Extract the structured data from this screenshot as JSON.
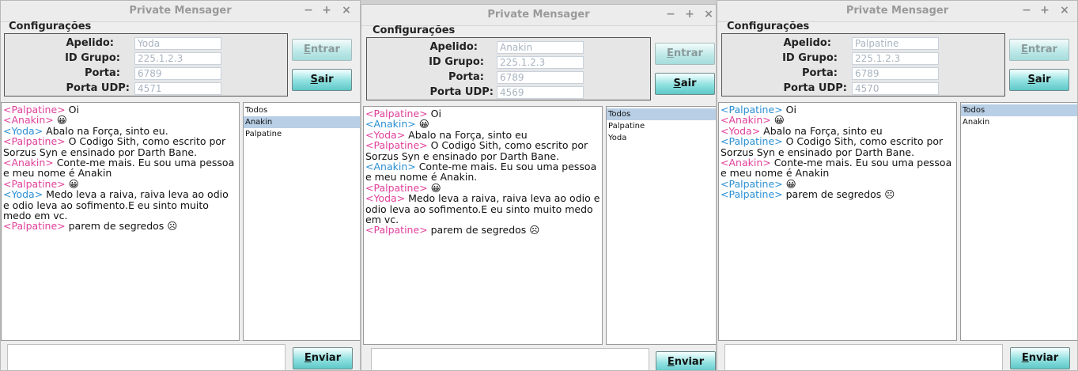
{
  "colors": {
    "palpatine": "#e0409a",
    "anakin": "#e0409a",
    "yoda": "#2a8fd4"
  },
  "common": {
    "window_title": "Private Mensager",
    "config_label": "Configurações",
    "apelido_label": "Apelido:",
    "grupo_label": "ID Grupo:",
    "porta_label": "Porta:",
    "udp_label": "Porta UDP:",
    "enter_label": "Entrar",
    "exit_label": "Sair",
    "send_label": "Enviar",
    "minimize": "−",
    "maximize": "+",
    "close": "×"
  },
  "windows": [
    {
      "apelido": "Yoda",
      "grupo": "225.1.2.3",
      "porta": "6789",
      "udp": "4571",
      "messages": [
        {
          "nick": "<Palpatine>",
          "who": "palpatine",
          "text": " Oi"
        },
        {
          "nick": "<Anakin>",
          "who": "anakin",
          "text": " 😀"
        },
        {
          "nick": "<Yoda>",
          "who": "yoda",
          "text": " Abalo na Força, sinto eu."
        },
        {
          "nick": "<Palpatine>",
          "who": "palpatine",
          "text": " O Codigo Sith, como escrito por Sorzus Syn e ensinado por Darth Bane."
        },
        {
          "nick": "<Anakin>",
          "who": "anakin",
          "text": " Conte-me mais. Eu sou uma pessoa e meu nome é Anakin"
        },
        {
          "nick": "<Palpatine>",
          "who": "palpatine",
          "text": " 😀"
        },
        {
          "nick": "<Yoda>",
          "who": "yoda",
          "text": " Medo leva a raiva, raiva leva ao odio e odio leva ao sofimento.E eu sinto muito medo em vc."
        },
        {
          "nick": "<Palpatine>",
          "who": "palpatine",
          "text": " parem de segredos ☹"
        }
      ],
      "users": [
        {
          "name": "Todos",
          "selected": false
        },
        {
          "name": "Anakin",
          "selected": true
        },
        {
          "name": "Palpatine",
          "selected": false
        }
      ]
    },
    {
      "apelido": "Anakin",
      "grupo": "225.1.2.3",
      "porta": "6789",
      "udp": "4569",
      "messages": [
        {
          "nick": "<Palpatine>",
          "who": "palpatine",
          "text": " Oi"
        },
        {
          "nick": "<Anakin>",
          "who": "yoda",
          "text": " 😀"
        },
        {
          "nick": "<Yoda>",
          "who": "anakin",
          "text": " Abalo na Força, sinto eu"
        },
        {
          "nick": "<Palpatine>",
          "who": "palpatine",
          "text": " O Codigo Sith, como escrito por Sorzus Syn e ensinado por Darth Bane."
        },
        {
          "nick": "<Anakin>",
          "who": "yoda",
          "text": " Conte-me mais. Eu sou uma pessoa e meu nome é Anakin."
        },
        {
          "nick": "<Palpatine>",
          "who": "palpatine",
          "text": " 😀"
        },
        {
          "nick": "<Yoda>",
          "who": "anakin",
          "text": " Medo leva a raiva, raiva leva ao odio e odio leva ao sofimento.E eu sinto muito medo em vc."
        },
        {
          "nick": "<Palpatine>",
          "who": "palpatine",
          "text": " parem de segredos ☹"
        }
      ],
      "users": [
        {
          "name": "Todos",
          "selected": true
        },
        {
          "name": "Palpatine",
          "selected": false
        },
        {
          "name": "Yoda",
          "selected": false
        }
      ]
    },
    {
      "apelido": "Palpatine",
      "grupo": "225.1.2.3",
      "porta": "6789",
      "udp": "4570",
      "messages": [
        {
          "nick": "<Palpatine>",
          "who": "yoda",
          "text": " Oi"
        },
        {
          "nick": "<Anakin>",
          "who": "anakin",
          "text": " 😀"
        },
        {
          "nick": "<Yoda>",
          "who": "anakin",
          "text": " Abalo na Força, sinto eu"
        },
        {
          "nick": "<Palpatine>",
          "who": "yoda",
          "text": " O Codigo Sith, como escrito por Sorzus Syn e ensinado por Darth Bane."
        },
        {
          "nick": "<Anakin>",
          "who": "anakin",
          "text": " Conte-me mais. Eu sou uma pessoa e meu nome é Anakin"
        },
        {
          "nick": "<Palpatine>",
          "who": "yoda",
          "text": " 😀"
        },
        {
          "nick": "<Palpatine>",
          "who": "yoda",
          "text": " parem de segredos ☹"
        }
      ],
      "users": [
        {
          "name": "Todos",
          "selected": true
        },
        {
          "name": "Anakin",
          "selected": false
        }
      ]
    }
  ]
}
